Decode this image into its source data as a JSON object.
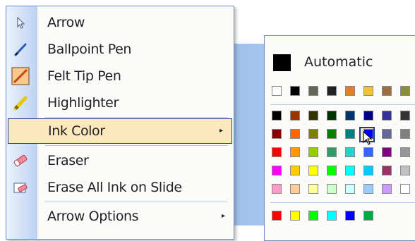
{
  "pen_menu": {
    "items": [
      {
        "label": "Arrow",
        "icon": "arrow-pointer-icon"
      },
      {
        "label": "Ballpoint Pen",
        "icon": "ballpoint-pen-icon"
      },
      {
        "label": "Felt Tip Pen",
        "icon": "felt-tip-pen-icon"
      },
      {
        "label": "Highlighter",
        "icon": "highlighter-icon"
      },
      {
        "label": "Ink Color",
        "icon": "",
        "submenu": true,
        "highlighted": true
      },
      {
        "label": "Eraser",
        "icon": "eraser-icon"
      },
      {
        "label": "Erase All Ink on Slide",
        "icon": "erase-all-ink-icon"
      },
      {
        "label": "Arrow Options",
        "icon": "",
        "submenu": true
      }
    ],
    "submenu_arrow": "▸"
  },
  "color_menu": {
    "automatic_label": "Automatic",
    "automatic_color": "#000000",
    "recent_colors": [
      "#ffffff",
      "#000000",
      "#666655",
      "#222222",
      "#e08020",
      "#f0c040",
      "#9a7040",
      "#8a9030"
    ],
    "grid": [
      [
        "#000000",
        "#993300",
        "#333300",
        "#003300",
        "#003366",
        "#000080",
        "#333399",
        "#333333"
      ],
      [
        "#800000",
        "#ff6600",
        "#808000",
        "#008000",
        "#008080",
        "#0000ff",
        "#666699",
        "#808080"
      ],
      [
        "#ff0000",
        "#ff9900",
        "#99cc00",
        "#339966",
        "#33cccc",
        "#3366ff",
        "#800080",
        "#969696"
      ],
      [
        "#ff00ff",
        "#ffcc00",
        "#ffff00",
        "#00ff00",
        "#00ffff",
        "#00ccff",
        "#993366",
        "#c0c0c0"
      ],
      [
        "#ff99cc",
        "#ffcc99",
        "#ffff99",
        "#ccffcc",
        "#ccffff",
        "#99ccff",
        "#cc99ff",
        "#ffffff"
      ]
    ],
    "bottom_colors": [
      "#ff0000",
      "#ffff00",
      "#00ff00",
      "#00ffff",
      "#0000ff",
      "#00aa44"
    ],
    "selected_color": "#0000ff"
  }
}
